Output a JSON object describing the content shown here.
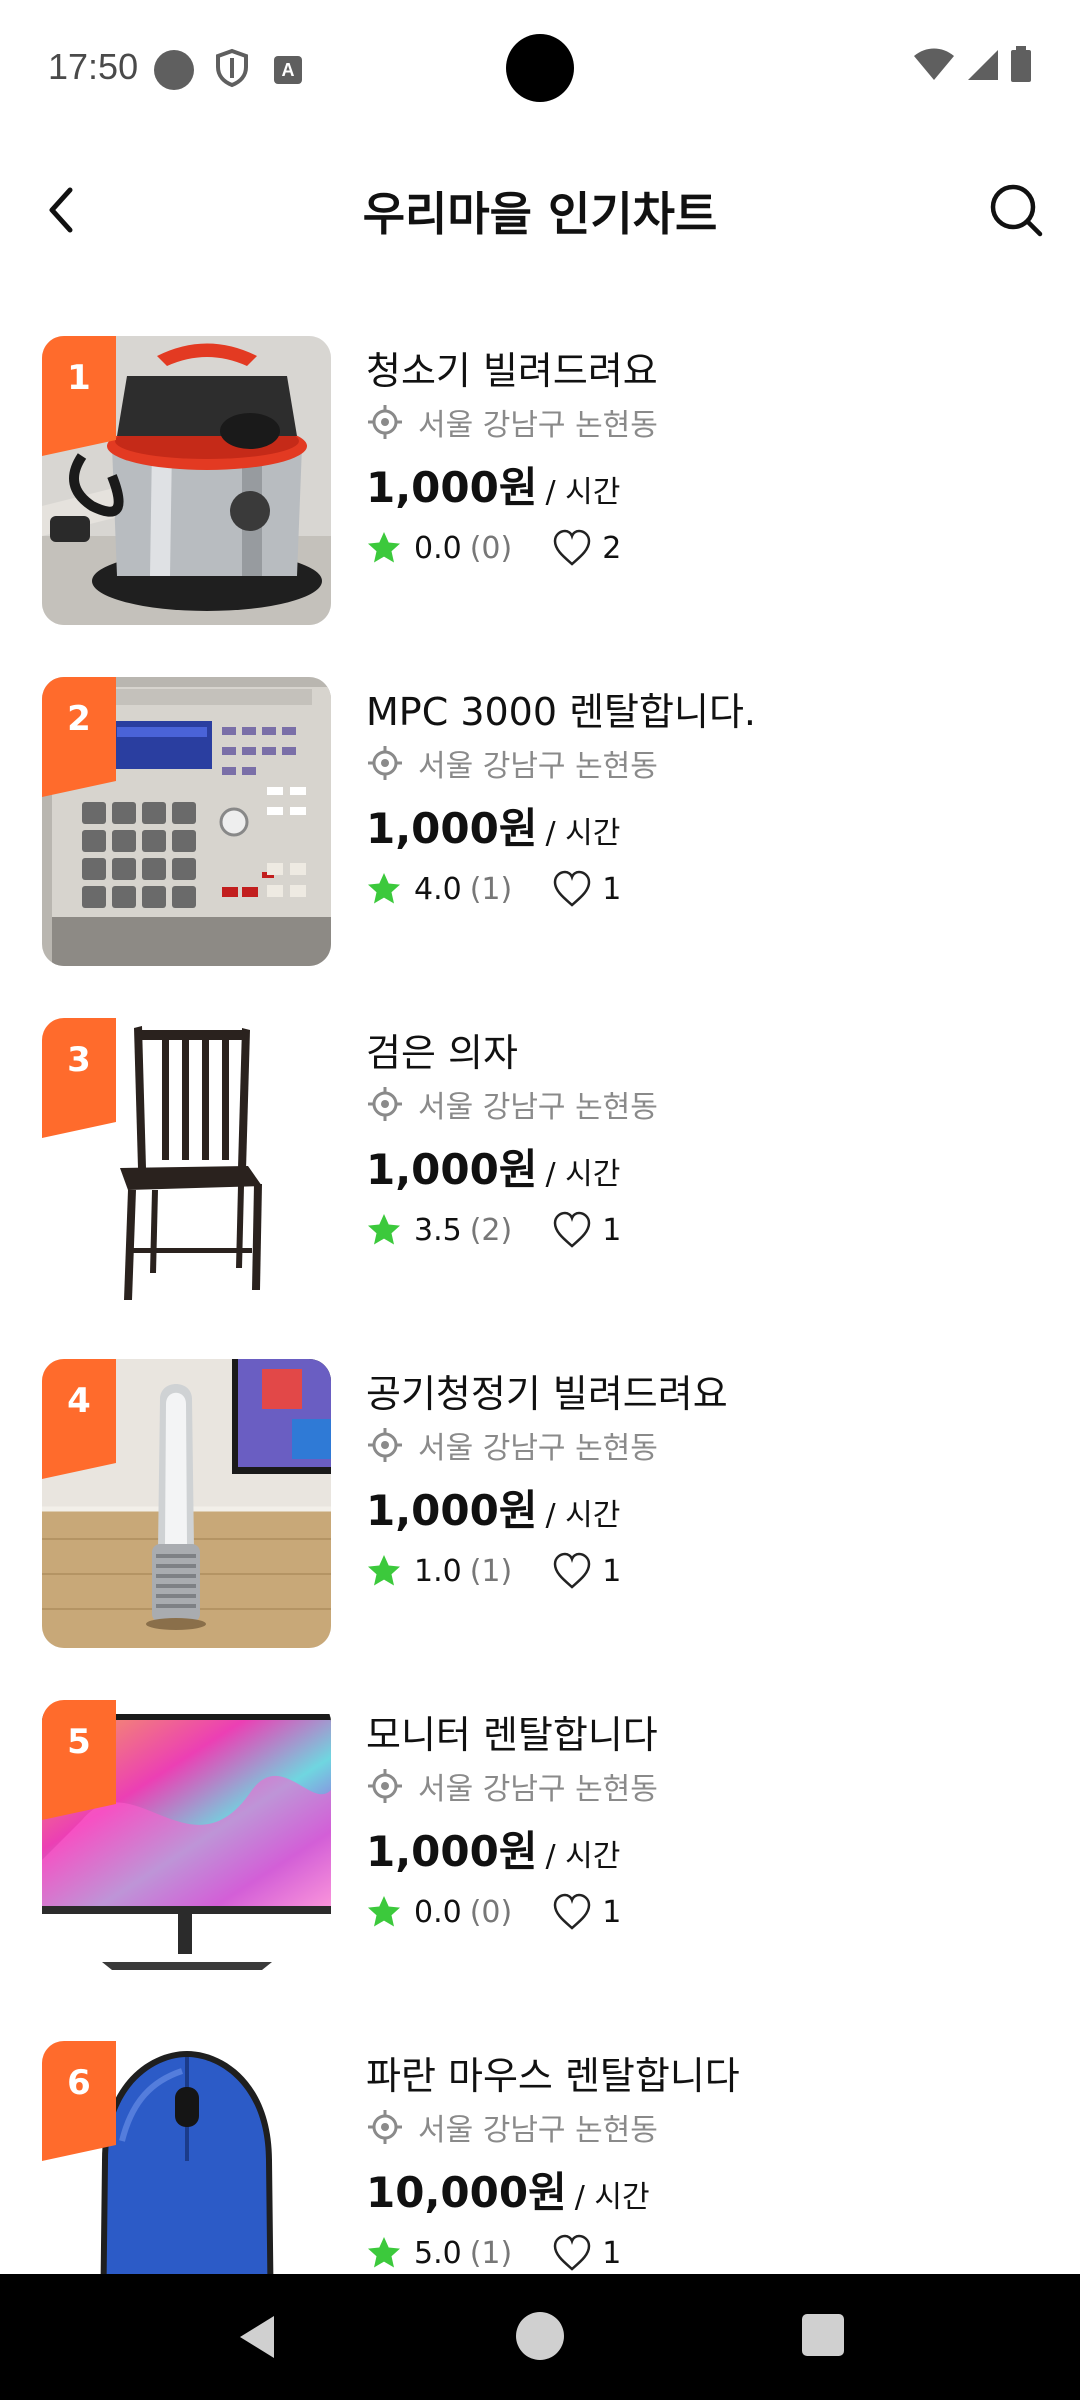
{
  "status_bar": {
    "time": "17:50",
    "left_icons": [
      "notification-dot-icon",
      "shield-icon",
      "font-a-icon"
    ],
    "right_icons": [
      "wifi-icon",
      "signal-icon",
      "battery-icon"
    ],
    "font_icon_label": "A"
  },
  "header": {
    "title": "우리마을 인기차트",
    "back_icon": "chevron-left-icon",
    "search_icon": "search-icon"
  },
  "colors": {
    "accent_orange": "#FF6B2C",
    "star_green": "#3CC93C",
    "muted_gray": "#8A8A8A"
  },
  "items": [
    {
      "rank": "1",
      "title": "청소기 빌려드려요",
      "location": "서울 강남구 논현동",
      "price": "1,000원",
      "unit": "/ 시간",
      "rating": "0.0",
      "rating_count": "(0)",
      "likes": "2",
      "image": "vacuum-cleaner"
    },
    {
      "rank": "2",
      "title": "MPC 3000 렌탈합니다.",
      "location": "서울 강남구 논현동",
      "price": "1,000원",
      "unit": "/ 시간",
      "rating": "4.0",
      "rating_count": "(1)",
      "likes": "1",
      "image": "mpc-sampler"
    },
    {
      "rank": "3",
      "title": "검은 의자",
      "location": "서울 강남구 논현동",
      "price": "1,000원",
      "unit": "/ 시간",
      "rating": "3.5",
      "rating_count": "(2)",
      "likes": "1",
      "image": "black-chair"
    },
    {
      "rank": "4",
      "title": "공기청정기 빌려드려요",
      "location": "서울 강남구 논현동",
      "price": "1,000원",
      "unit": "/ 시간",
      "rating": "1.0",
      "rating_count": "(1)",
      "likes": "1",
      "image": "air-purifier"
    },
    {
      "rank": "5",
      "title": "모니터 렌탈합니다",
      "location": "서울 강남구 논현동",
      "price": "1,000원",
      "unit": "/ 시간",
      "rating": "0.0",
      "rating_count": "(0)",
      "likes": "1",
      "image": "monitor"
    },
    {
      "rank": "6",
      "title": "파란 마우스 렌탈합니다",
      "location": "서울 강남구 논현동",
      "price": "10,000원",
      "unit": "/ 시간",
      "rating": "5.0",
      "rating_count": "(1)",
      "likes": "1",
      "image": "blue-mouse"
    }
  ],
  "nav_bar": {
    "icons": [
      "nav-back-icon",
      "nav-home-icon",
      "nav-recents-icon"
    ]
  }
}
